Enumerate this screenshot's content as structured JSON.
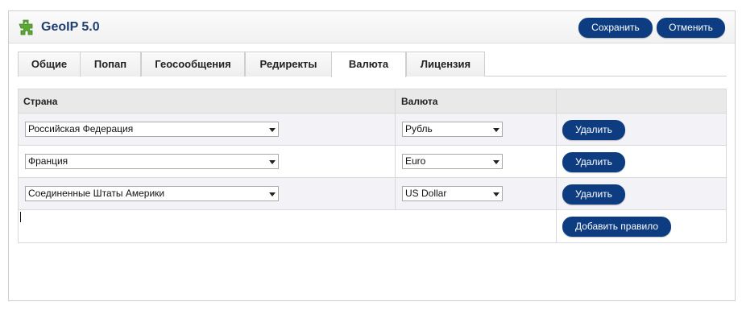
{
  "app": {
    "title": "GeoIP 5.0"
  },
  "toolbar": {
    "save_label": "Сохранить",
    "cancel_label": "Отменить"
  },
  "tabs": [
    {
      "label": "Общие"
    },
    {
      "label": "Попап"
    },
    {
      "label": "Геосообщения"
    },
    {
      "label": "Редиректы"
    },
    {
      "label": "Валюта",
      "active": true
    },
    {
      "label": "Лицензия"
    }
  ],
  "table": {
    "headers": {
      "country": "Страна",
      "currency": "Валюта"
    },
    "rows": [
      {
        "country": "Российская Федерация",
        "currency": "Рубль",
        "delete_label": "Удалить"
      },
      {
        "country": "Франция",
        "currency": "Euro",
        "delete_label": "Удалить"
      },
      {
        "country": "Соединенные Штаты Америки",
        "currency": "US Dollar",
        "delete_label": "Удалить"
      }
    ],
    "add_rule_label": "Добавить правило"
  },
  "colors": {
    "accent": "#0d3d80",
    "title": "#1f3f73",
    "icon": "#5aa832"
  },
  "icons": {
    "logo": "puzzle-icon",
    "dropdown": "chevron-down-icon"
  }
}
